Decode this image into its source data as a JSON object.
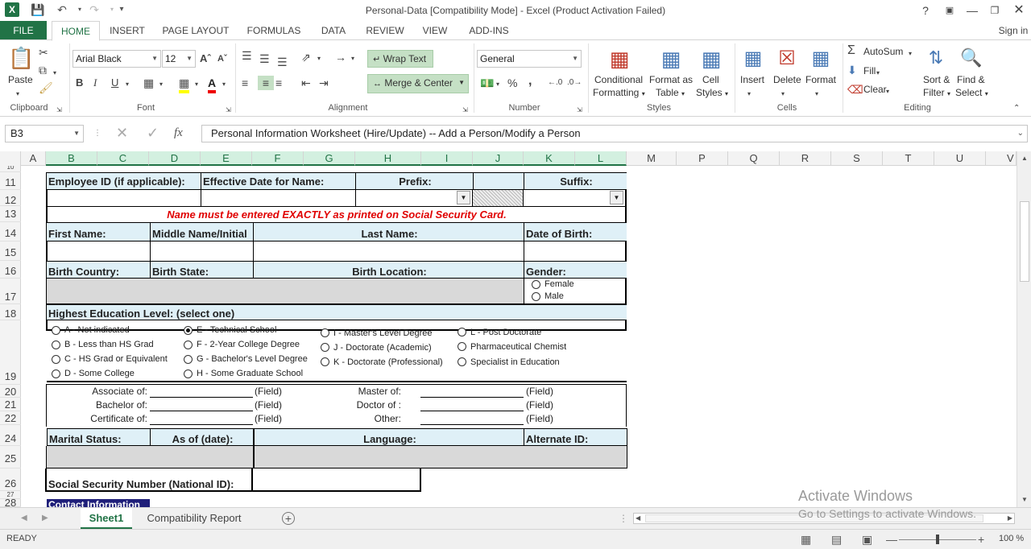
{
  "window": {
    "title": "Personal-Data  [Compatibility Mode] - Excel (Product Activation Failed)",
    "help": "?",
    "sign_in": "Sign in"
  },
  "tabs": [
    "FILE",
    "HOME",
    "INSERT",
    "PAGE LAYOUT",
    "FORMULAS",
    "DATA",
    "REVIEW",
    "VIEW",
    "ADD-INS"
  ],
  "ribbon": {
    "clipboard": {
      "paste": "Paste",
      "label": "Clipboard"
    },
    "font": {
      "name": "Arial Black",
      "size": "12",
      "label": "Font",
      "bold": "B",
      "italic": "I",
      "underline": "U"
    },
    "alignment": {
      "wrap": "Wrap Text",
      "merge": "Merge & Center",
      "label": "Alignment"
    },
    "number": {
      "format": "General",
      "label": "Number",
      "percent": "%",
      "comma": ","
    },
    "styles": {
      "cond1": "Conditional",
      "cond2": "Formatting",
      "fmt1": "Format as",
      "fmt2": "Table",
      "cell1": "Cell",
      "cell2": "Styles",
      "label": "Styles"
    },
    "cells": {
      "insert": "Insert",
      "delete": "Delete",
      "format": "Format",
      "label": "Cells"
    },
    "editing": {
      "autosum": "AutoSum",
      "fill": "Fill",
      "clear": "Clear",
      "sort1": "Sort &",
      "sort2": "Filter",
      "find1": "Find &",
      "find2": "Select",
      "label": "Editing"
    }
  },
  "formula_bar": {
    "name_box": "B3",
    "fx": "fx",
    "content": "Personal Information Worksheet (Hire/Update) -- Add a Person/Modify a Person"
  },
  "columns": [
    "A",
    "B",
    "C",
    "D",
    "E",
    "F",
    "G",
    "H",
    "I",
    "J",
    "K",
    "L",
    "M",
    "P",
    "Q",
    "R",
    "S",
    "T",
    "U",
    "V"
  ],
  "rows": [
    "10",
    "11",
    "12",
    "13",
    "14",
    "15",
    "16",
    "17",
    "18",
    "19",
    "20",
    "21",
    "22",
    "24",
    "25",
    "26",
    "27",
    "28"
  ],
  "form": {
    "employee_id": "Employee ID (if applicable):",
    "eff_date": "Effective Date for Name:",
    "prefix": "Prefix:",
    "suffix": "Suffix:",
    "name_warning": "Name must be entered EXACTLY as printed on Social Security Card.",
    "first_name": "First Name:",
    "middle_name": "Middle Name/Initial",
    "last_name": "Last Name:",
    "dob": "Date of Birth:",
    "birth_country": "Birth Country:",
    "birth_state": "Birth State:",
    "birth_location": "Birth Location:",
    "gender": "Gender:",
    "female": "Female",
    "male": "Male",
    "education": "Highest Education Level: (select one)",
    "edu_col1": [
      "A - Not indicated",
      "B - Less than HS Grad",
      "C - HS Grad or Equivalent",
      "D - Some College"
    ],
    "edu_col2": [
      "E - Technical School",
      "F - 2-Year College Degree",
      "G - Bachelor's Level Degree",
      "H - Some Graduate School"
    ],
    "edu_col3": [
      "I - Master's Level Degree",
      "J - Doctorate (Academic)",
      "K - Doctorate (Professional)"
    ],
    "edu_col4": [
      "L - Post Doctorate",
      "Pharmaceutical Chemist",
      "Specialist in Education"
    ],
    "associate": "Associate of:",
    "bachelor": "Bachelor of:",
    "certificate": "Certificate of:",
    "master": "Master of:",
    "doctor": "Doctor of :",
    "other": "Other:",
    "field": "(Field)",
    "marital": "Marital Status:",
    "as_of": "As of (date):",
    "language": "Language:",
    "alt_id": "Alternate ID:",
    "ssn": "Social Security Number (National ID):",
    "contact": "Contact Information"
  },
  "sheets": [
    "Sheet1",
    "Compatibility Report"
  ],
  "status": {
    "ready": "READY",
    "zoom": "100 %"
  },
  "watermark": {
    "line1": "Activate Windows",
    "line2": "Go to Settings to activate Windows."
  }
}
